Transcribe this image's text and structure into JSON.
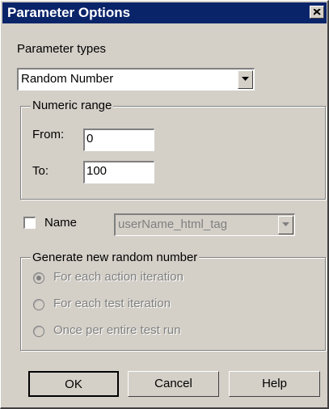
{
  "window": {
    "title": "Parameter Options"
  },
  "parameter_types": {
    "label": "Parameter types",
    "selected": "Random Number"
  },
  "numeric_range": {
    "title": "Numeric range",
    "from_label": "From:",
    "from_value": "0",
    "to_label": "To:",
    "to_value": "100"
  },
  "name": {
    "label": "Name",
    "checked": false,
    "value": "userName_html_tag"
  },
  "generate": {
    "title": "Generate new random number",
    "options": [
      {
        "label": "For each action iteration",
        "selected": true
      },
      {
        "label": "For each test iteration",
        "selected": false
      },
      {
        "label": "Once per entire test run",
        "selected": false
      }
    ]
  },
  "buttons": {
    "ok": "OK",
    "cancel": "Cancel",
    "help": "Help"
  }
}
